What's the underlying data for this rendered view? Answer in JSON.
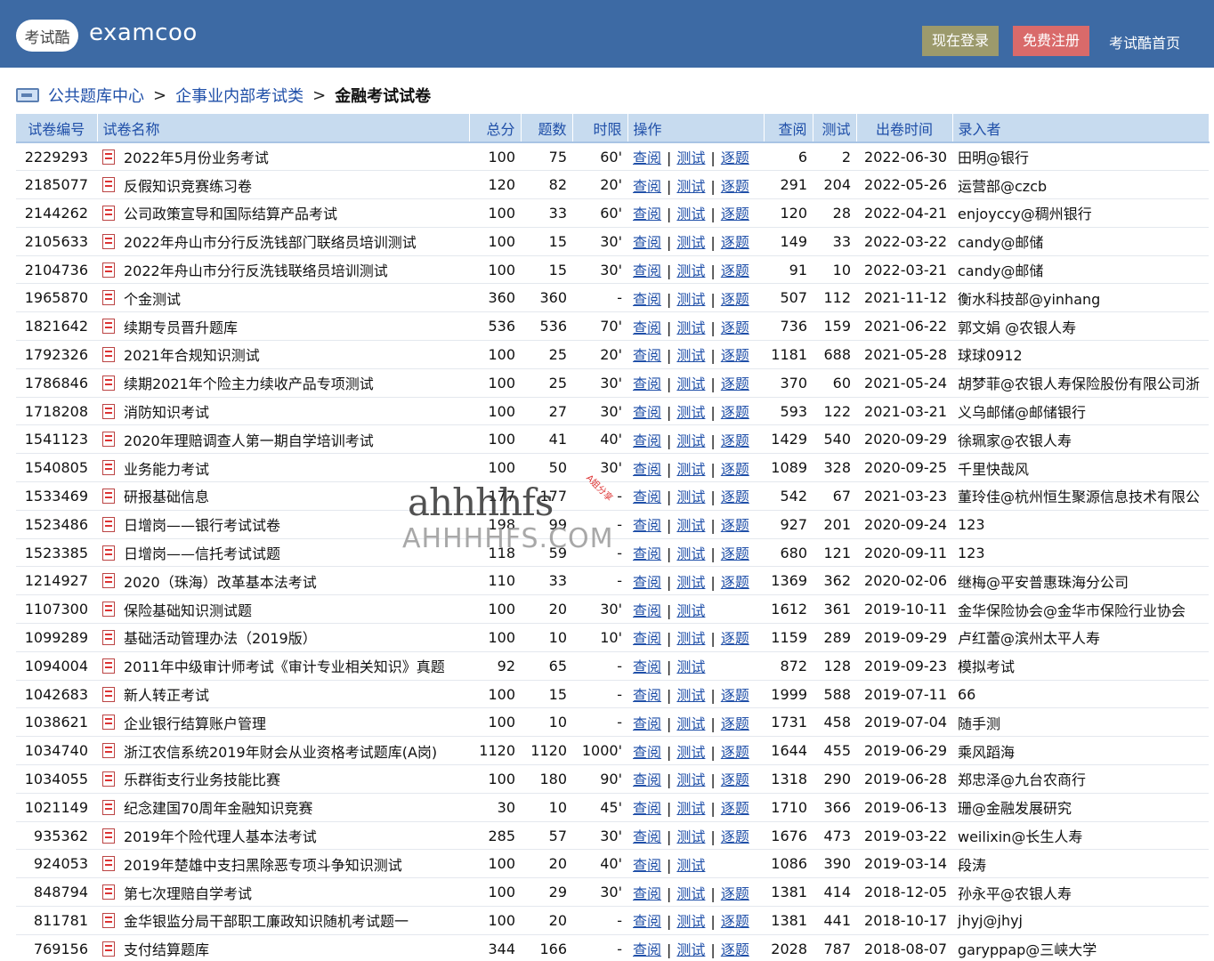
{
  "header": {
    "logo_text": "考试酷",
    "brand": "examcoo",
    "login_label": "现在登录",
    "register_label": "免费注册",
    "home_label": "考试酷首页"
  },
  "breadcrumb": {
    "items": [
      "公共题库中心",
      "企事业内部考试类"
    ],
    "separator": ">",
    "current": "金融考试试卷"
  },
  "table": {
    "columns": [
      "试卷编号",
      "试卷名称",
      "总分",
      "题数",
      "时限",
      "操作",
      "查阅",
      "测试",
      "出卷时间",
      "录入者"
    ],
    "op_labels": {
      "view": "查阅",
      "test": "测试",
      "step": "逐题",
      "sep": "|"
    },
    "rows": [
      {
        "id": "2229293",
        "name": "2022年5月份业务考试",
        "score": "100",
        "count": "75",
        "limit": "60'",
        "step": true,
        "views": "6",
        "tests": "2",
        "date": "2022-06-30",
        "by": "田明@银行"
      },
      {
        "id": "2185077",
        "name": "反假知识竞赛练习卷",
        "score": "120",
        "count": "82",
        "limit": "20'",
        "step": true,
        "views": "291",
        "tests": "204",
        "date": "2022-05-26",
        "by": "运营部@czcb"
      },
      {
        "id": "2144262",
        "name": "公司政策宣导和国际结算产品考试",
        "score": "100",
        "count": "33",
        "limit": "60'",
        "step": true,
        "views": "120",
        "tests": "28",
        "date": "2022-04-21",
        "by": "enjoyccy@稠州银行"
      },
      {
        "id": "2105633",
        "name": "2022年舟山市分行反洗钱部门联络员培训测试",
        "score": "100",
        "count": "15",
        "limit": "30'",
        "step": true,
        "views": "149",
        "tests": "33",
        "date": "2022-03-22",
        "by": "candy@邮储"
      },
      {
        "id": "2104736",
        "name": "2022年舟山市分行反洗钱联络员培训测试",
        "score": "100",
        "count": "15",
        "limit": "30'",
        "step": true,
        "views": "91",
        "tests": "10",
        "date": "2022-03-21",
        "by": "candy@邮储"
      },
      {
        "id": "1965870",
        "name": "个金测试",
        "score": "360",
        "count": "360",
        "limit": "-",
        "step": true,
        "views": "507",
        "tests": "112",
        "date": "2021-11-12",
        "by": "衡水科技部@yinhang"
      },
      {
        "id": "1821642",
        "name": "续期专员晋升题库",
        "score": "536",
        "count": "536",
        "limit": "70'",
        "step": true,
        "views": "736",
        "tests": "159",
        "date": "2021-06-22",
        "by": "郭文娟 @农银人寿"
      },
      {
        "id": "1792326",
        "name": "2021年合规知识测试",
        "score": "100",
        "count": "25",
        "limit": "20'",
        "step": true,
        "views": "1181",
        "tests": "688",
        "date": "2021-05-28",
        "by": "球球0912"
      },
      {
        "id": "1786846",
        "name": "续期2021年个险主力续收产品专项测试",
        "score": "100",
        "count": "25",
        "limit": "30'",
        "step": true,
        "views": "370",
        "tests": "60",
        "date": "2021-05-24",
        "by": "胡梦菲@农银人寿保险股份有限公司浙"
      },
      {
        "id": "1718208",
        "name": "消防知识考试",
        "score": "100",
        "count": "27",
        "limit": "30'",
        "step": true,
        "views": "593",
        "tests": "122",
        "date": "2021-03-21",
        "by": "义乌邮储@邮储银行"
      },
      {
        "id": "1541123",
        "name": "2020年理赔调查人第一期自学培训考试",
        "score": "100",
        "count": "41",
        "limit": "40'",
        "step": true,
        "views": "1429",
        "tests": "540",
        "date": "2020-09-29",
        "by": "徐珮家@农银人寿"
      },
      {
        "id": "1540805",
        "name": "业务能力考试",
        "score": "100",
        "count": "50",
        "limit": "30'",
        "step": true,
        "views": "1089",
        "tests": "328",
        "date": "2020-09-25",
        "by": "千里快哉风"
      },
      {
        "id": "1533469",
        "name": "研报基础信息",
        "score": "177",
        "count": "177",
        "limit": "-",
        "step": true,
        "views": "542",
        "tests": "67",
        "date": "2021-03-23",
        "by": "董玲佳@杭州恒生聚源信息技术有限公"
      },
      {
        "id": "1523486",
        "name": "日增岗——银行考试试卷",
        "score": "198",
        "count": "99",
        "limit": "-",
        "step": true,
        "views": "927",
        "tests": "201",
        "date": "2020-09-24",
        "by": "123"
      },
      {
        "id": "1523385",
        "name": "日增岗——信托考试试题",
        "score": "118",
        "count": "59",
        "limit": "-",
        "step": true,
        "views": "680",
        "tests": "121",
        "date": "2020-09-11",
        "by": "123"
      },
      {
        "id": "1214927",
        "name": "2020（珠海）改革基本法考试",
        "score": "110",
        "count": "33",
        "limit": "-",
        "step": true,
        "views": "1369",
        "tests": "362",
        "date": "2020-02-06",
        "by": "继梅@平安普惠珠海分公司"
      },
      {
        "id": "1107300",
        "name": "保险基础知识测试题",
        "score": "100",
        "count": "20",
        "limit": "30'",
        "step": false,
        "views": "1612",
        "tests": "361",
        "date": "2019-10-11",
        "by": "金华保险协会@金华市保险行业协会"
      },
      {
        "id": "1099289",
        "name": "基础活动管理办法（2019版）",
        "score": "100",
        "count": "10",
        "limit": "10'",
        "step": true,
        "views": "1159",
        "tests": "289",
        "date": "2019-09-29",
        "by": "卢红蕾@滨州太平人寿"
      },
      {
        "id": "1094004",
        "name": "2011年中级审计师考试《审计专业相关知识》真题",
        "score": "92",
        "count": "65",
        "limit": "-",
        "step": false,
        "views": "872",
        "tests": "128",
        "date": "2019-09-23",
        "by": "模拟考试"
      },
      {
        "id": "1042683",
        "name": "新人转正考试",
        "score": "100",
        "count": "15",
        "limit": "-",
        "step": true,
        "views": "1999",
        "tests": "588",
        "date": "2019-07-11",
        "by": "66"
      },
      {
        "id": "1038621",
        "name": "企业银行结算账户管理",
        "score": "100",
        "count": "10",
        "limit": "-",
        "step": true,
        "views": "1731",
        "tests": "458",
        "date": "2019-07-04",
        "by": "随手测"
      },
      {
        "id": "1034740",
        "name": "浙江农信系统2019年财会从业资格考试题库(A岗)",
        "score": "1120",
        "count": "1120",
        "limit": "1000'",
        "step": true,
        "views": "1644",
        "tests": "455",
        "date": "2019-06-29",
        "by": "乘风蹈海"
      },
      {
        "id": "1034055",
        "name": "乐群街支行业务技能比赛",
        "score": "100",
        "count": "180",
        "limit": "90'",
        "step": true,
        "views": "1318",
        "tests": "290",
        "date": "2019-06-28",
        "by": "郑忠泽@九台农商行"
      },
      {
        "id": "1021149",
        "name": "纪念建国70周年金融知识竞赛",
        "score": "30",
        "count": "10",
        "limit": "45'",
        "step": true,
        "views": "1710",
        "tests": "366",
        "date": "2019-06-13",
        "by": "珊@金融发展研究"
      },
      {
        "id": "935362",
        "name": "2019年个险代理人基本法考试",
        "score": "285",
        "count": "57",
        "limit": "30'",
        "step": true,
        "views": "1676",
        "tests": "473",
        "date": "2019-03-22",
        "by": "weilixin@长生人寿"
      },
      {
        "id": "924053",
        "name": "2019年楚雄中支扫黑除恶专项斗争知识测试",
        "score": "100",
        "count": "20",
        "limit": "40'",
        "step": false,
        "views": "1086",
        "tests": "390",
        "date": "2019-03-14",
        "by": "段涛"
      },
      {
        "id": "848794",
        "name": "第七次理赔自学考试",
        "score": "100",
        "count": "29",
        "limit": "30'",
        "step": true,
        "views": "1381",
        "tests": "414",
        "date": "2018-12-05",
        "by": "孙永平@农银人寿"
      },
      {
        "id": "811781",
        "name": "金华银监分局干部职工廉政知识随机考试题一",
        "score": "100",
        "count": "20",
        "limit": "-",
        "step": true,
        "views": "1381",
        "tests": "441",
        "date": "2018-10-17",
        "by": "jhyj@jhyj"
      },
      {
        "id": "769156",
        "name": "支付结算题库",
        "score": "344",
        "count": "166",
        "limit": "-",
        "step": true,
        "views": "2028",
        "tests": "787",
        "date": "2018-08-07",
        "by": "garyppap@三峡大学"
      }
    ]
  },
  "watermark": {
    "top": "ahhhhfs",
    "bottom": "AHHHHFS.COM",
    "tag": "A姐分享"
  }
}
